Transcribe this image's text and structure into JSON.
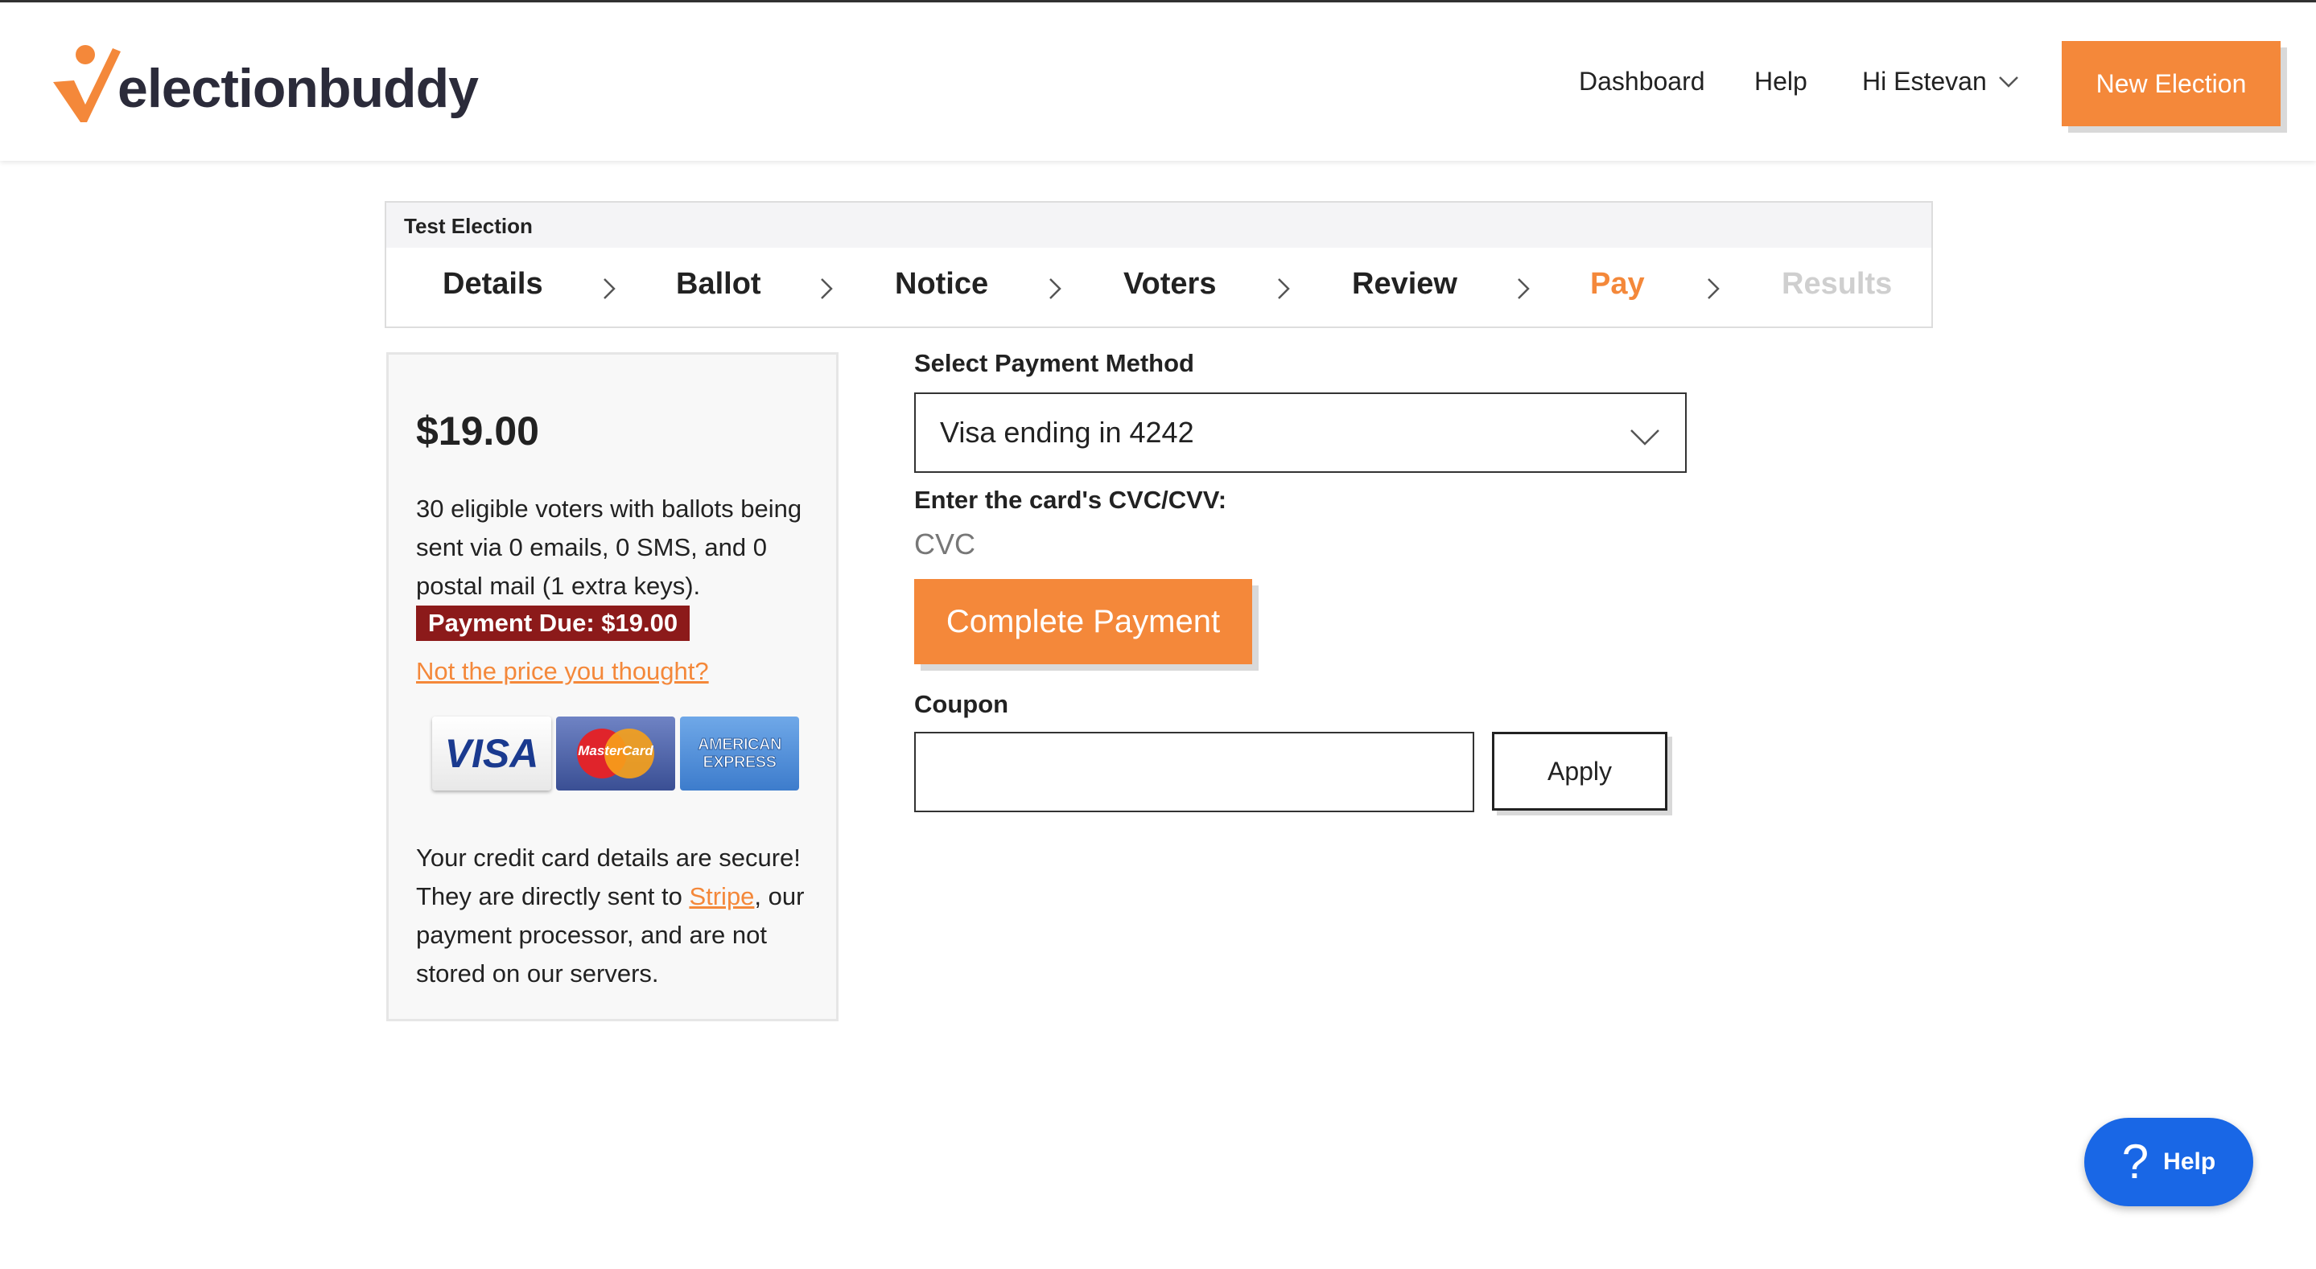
{
  "brand": {
    "name": "electionbuddy",
    "accent": "#f4883a"
  },
  "nav": {
    "dashboard": "Dashboard",
    "help": "Help",
    "user": "Hi Estevan",
    "new_election": "New Election"
  },
  "steps": {
    "election_title": "Test Election",
    "items": [
      {
        "label": "Details"
      },
      {
        "label": "Ballot"
      },
      {
        "label": "Notice"
      },
      {
        "label": "Voters"
      },
      {
        "label": "Review"
      },
      {
        "label": "Pay"
      },
      {
        "label": "Results"
      }
    ]
  },
  "summary": {
    "price": "$19.00",
    "description": "30 eligible voters with ballots being sent via 0 emails, 0 SMS, and 0 postal mail (1 extra keys).",
    "payment_due": "Payment Due: $19.00",
    "price_link": "Not the price you thought?",
    "cards": {
      "visa": "VISA",
      "mastercard": "MasterCard",
      "amex_line1": "AMERICAN",
      "amex_line2": "EXPRESS"
    },
    "secure_1": "Your credit card details are secure! They are directly sent to ",
    "stripe_link": "Stripe",
    "secure_2": ", our payment processor, and are not stored on our servers."
  },
  "payment": {
    "method_label": "Select Payment Method",
    "method_value": "Visa ending in 4242",
    "cvc_label": "Enter the card's CVC/CVV:",
    "cvc_placeholder": "CVC",
    "complete_button": "Complete Payment",
    "coupon_label": "Coupon",
    "coupon_value": "",
    "apply_button": "Apply"
  },
  "help_widget": {
    "icon": "?",
    "label": "Help"
  }
}
